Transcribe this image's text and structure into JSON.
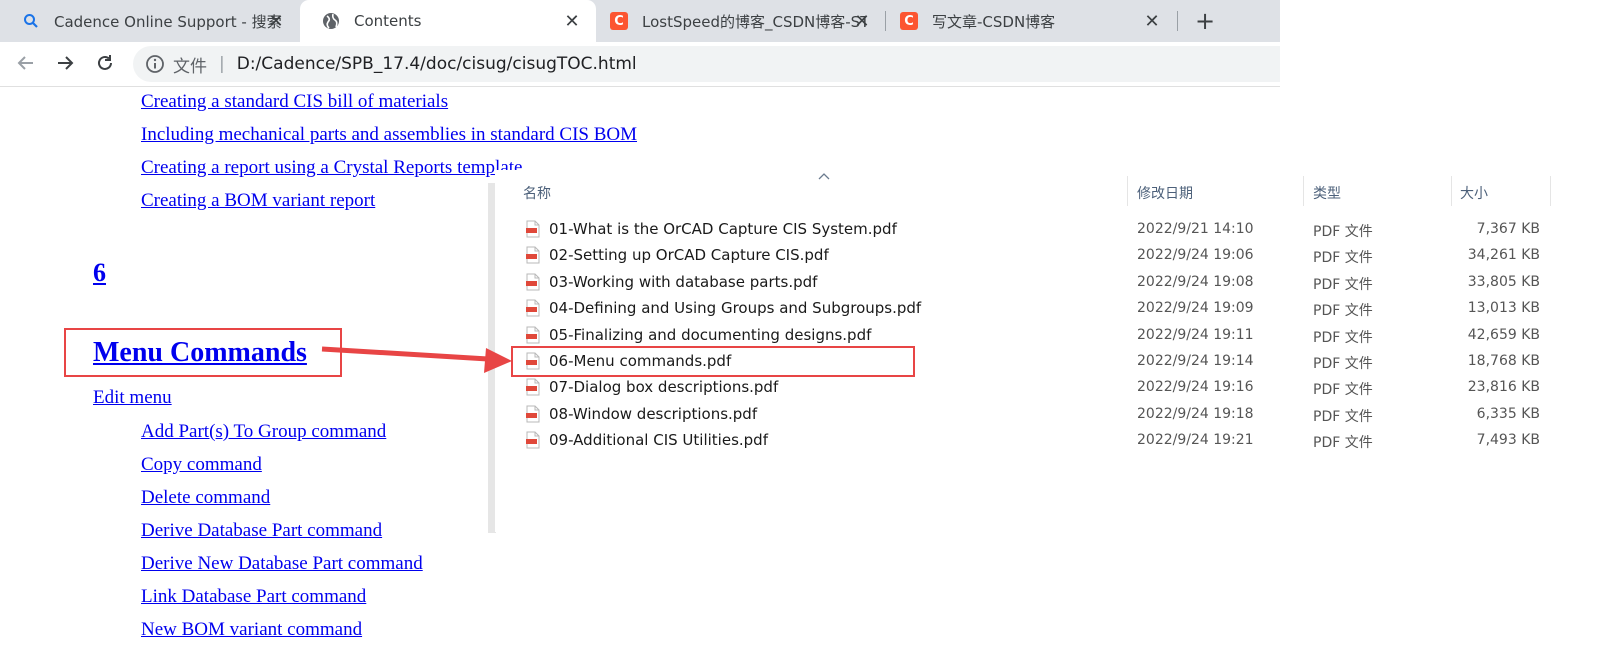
{
  "browser": {
    "tabs": [
      {
        "title": "Cadence Online Support - 搜索",
        "icon": "search-icon"
      },
      {
        "title": "Contents",
        "icon": "globe-icon",
        "active": true
      },
      {
        "title": "LostSpeed的博客_CSDN博客-ST",
        "icon": "csdn-logo"
      },
      {
        "title": "写文章-CSDN博客",
        "icon": "csdn-logo"
      }
    ],
    "csdn_letter": "C",
    "close_glyph": "✕",
    "new_tab_glyph": "+",
    "address": {
      "scheme_label": "文件",
      "separator": "|",
      "url": "D:/Cadence/SPB_17.4/doc/cisug/cisugTOC.html"
    }
  },
  "toc": {
    "top_links": [
      "Creating a standard CIS bill of materials",
      "Including mechanical parts and assemblies in standard CIS BOM",
      "Creating a report using a Crystal Reports template",
      "Creating a BOM variant report"
    ],
    "chapter_number": "6",
    "chapter_title": "Menu Commands",
    "section": "Edit menu",
    "section_links": [
      "Add Part(s) To Group command",
      "Copy command",
      "Delete command",
      "Derive Database Part command",
      "Derive New Database Part command",
      "Link Database Part command",
      "New BOM variant command"
    ]
  },
  "explorer": {
    "columns": {
      "name": "名称",
      "date": "修改日期",
      "type": "类型",
      "size": "大小"
    },
    "files": [
      {
        "name": "01-What is the OrCAD Capture CIS System.pdf",
        "date": "2022/9/21 14:10",
        "type": "PDF 文件",
        "size": "7,367 KB"
      },
      {
        "name": "02-Setting up OrCAD Capture CIS.pdf",
        "date": "2022/9/24 19:06",
        "type": "PDF 文件",
        "size": "34,261 KB"
      },
      {
        "name": "03-Working with database parts.pdf",
        "date": "2022/9/24 19:08",
        "type": "PDF 文件",
        "size": "33,805 KB"
      },
      {
        "name": "04-Defining and Using Groups and Subgroups.pdf",
        "date": "2022/9/24 19:09",
        "type": "PDF 文件",
        "size": "13,013 KB"
      },
      {
        "name": "05-Finalizing and documenting designs.pdf",
        "date": "2022/9/24 19:11",
        "type": "PDF 文件",
        "size": "42,659 KB"
      },
      {
        "name": "06-Menu commands.pdf",
        "date": "2022/9/24 19:14",
        "type": "PDF 文件",
        "size": "18,768 KB"
      },
      {
        "name": "07-Dialog box descriptions.pdf",
        "date": "2022/9/24 19:16",
        "type": "PDF 文件",
        "size": "23,816 KB"
      },
      {
        "name": "08-Window descriptions.pdf",
        "date": "2022/9/24 19:18",
        "type": "PDF 文件",
        "size": "6,335 KB"
      },
      {
        "name": "09-Additional CIS Utilities.pdf",
        "date": "2022/9/24 19:21",
        "type": "PDF 文件",
        "size": "7,493 KB"
      }
    ]
  },
  "colors": {
    "link": "#0000ee",
    "annotation": "#e84545",
    "csdn_brand": "#fc5531",
    "pdf_icon": "#e0483a"
  }
}
